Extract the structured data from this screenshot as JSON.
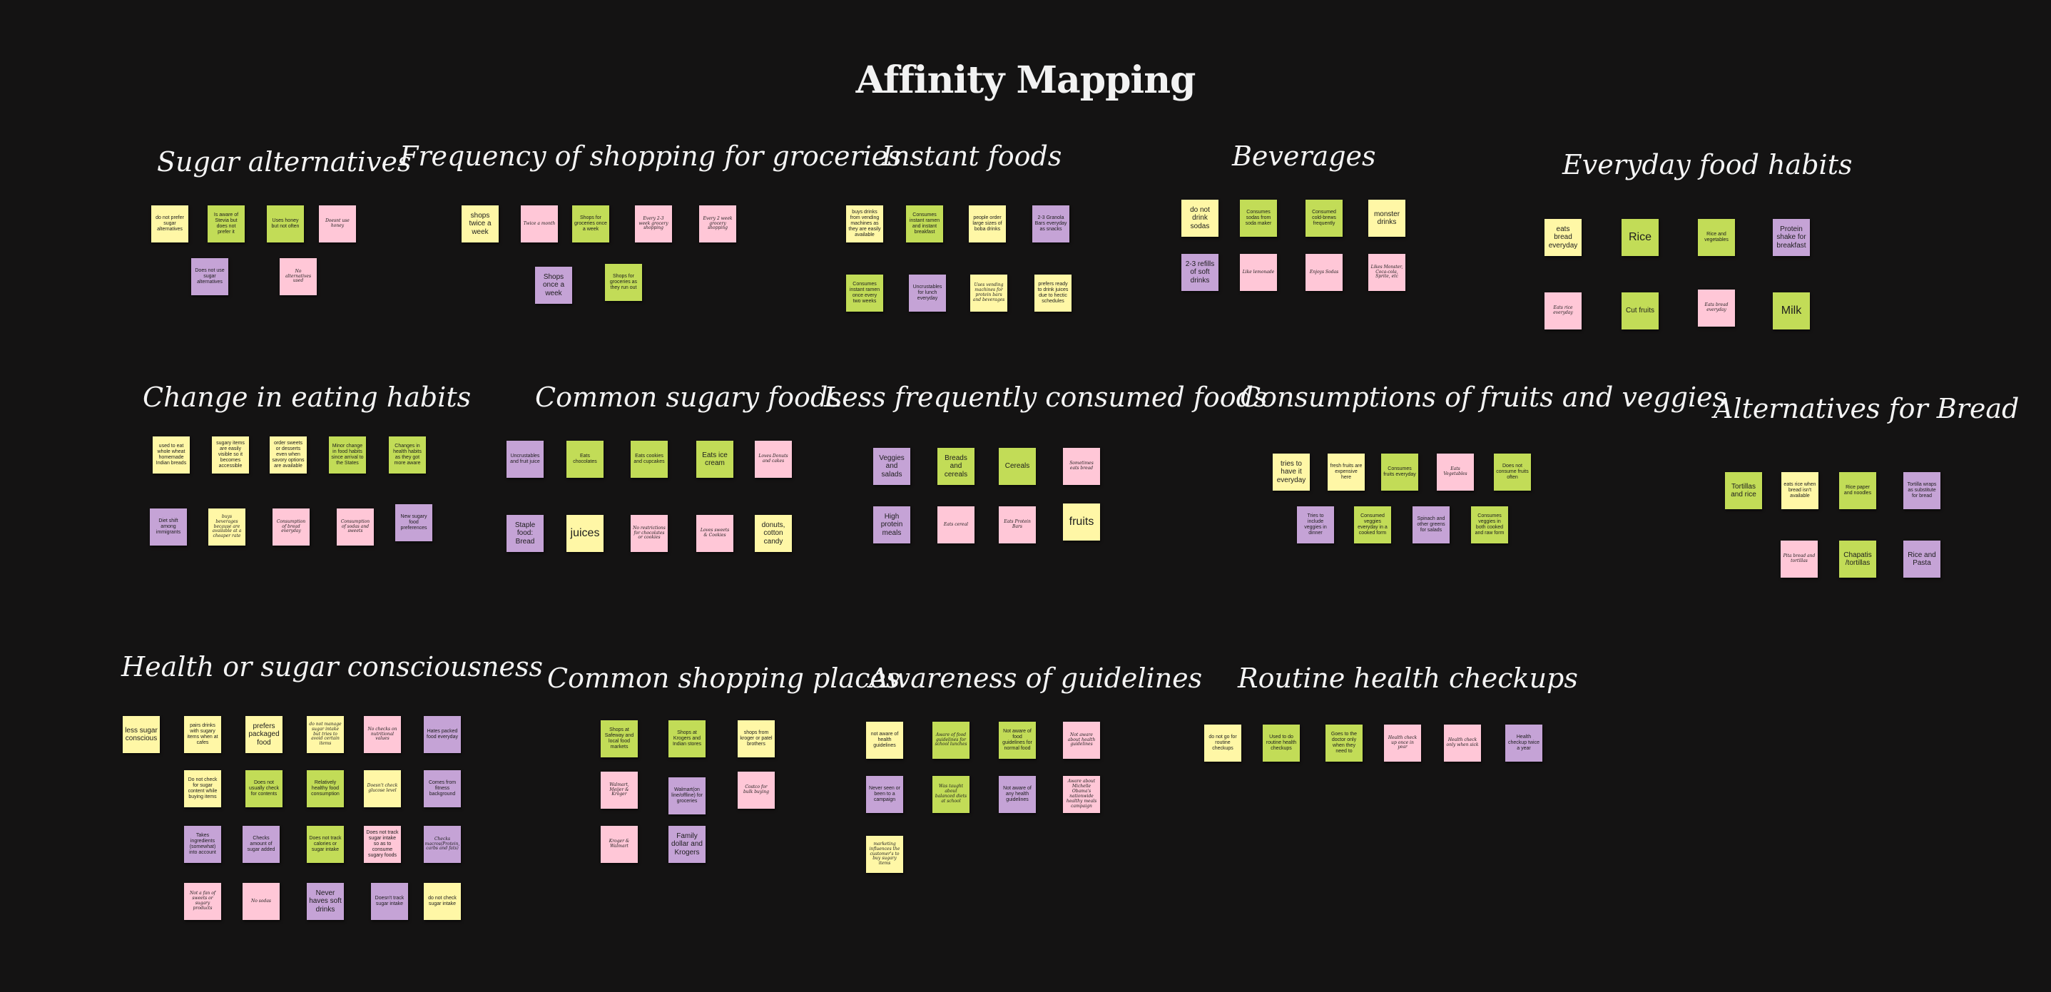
{
  "title": "Affinity Mapping",
  "colors": {
    "background": "#141313",
    "yellow": "#fff7a6",
    "green": "#c2dc57",
    "pink": "#ffc7d7",
    "purple": "#c5a3d6"
  },
  "clusters": [
    {
      "title": "Sugar alternatives",
      "notes": [
        "do not prefer sugar alternatives",
        "Is aware of Stevia but does not prefer it",
        "Uses honey but not often",
        "Doesnt use honey",
        "Does not use sugar alternatives",
        "No alternatives used"
      ]
    },
    {
      "title": "Frequency of shopping for groceries",
      "notes": [
        "shops twice a week",
        "Twice a month",
        "Shops for groceries once a week",
        "Every 2-3 week grocery shopping",
        "Every 2 week grocery shopping",
        "Shops once a week",
        "Shops for groceries as they run out"
      ]
    },
    {
      "title": "Instant foods",
      "notes": [
        "buys drinks from vending machines as they are easily available",
        "Consumes instant ramen and instant breakfast",
        "people order large sizes of boba drinks",
        "2-3 Granola Bars everyday as snacks",
        "Consumes instant ramen once every two weeks",
        "Uncrustables for lunch everyday",
        "Uses vending machines for protein bars and beverages",
        "prefers ready to drink juices due to hectic schedules"
      ]
    },
    {
      "title": "Beverages",
      "notes": [
        "do not drink sodas",
        "Consumes sodas from soda maker",
        "Consumed cold-brews frequently",
        "monster drinks",
        "2-3 refills of soft drinks",
        "Like lemonade",
        "Enjoys Sodas",
        "Likes Monster, Coca-cola, Sprite, etc"
      ]
    },
    {
      "title": "Everyday food habits",
      "notes": [
        "eats bread everyday",
        "Rice",
        "Rice and vegetables",
        "Protein shake for breakfast",
        "Eats rice everyday",
        "Cut fruits",
        "Eats bread everyday",
        "Milk"
      ]
    },
    {
      "title": "Change in eating habits",
      "notes": [
        "used to eat whole wheat homemade Indian breads",
        "sugary items are easily visible so it becomes accessible",
        "order sweets or desserts even when savory options are available",
        "Minor change in food habits since arrival to the States",
        "Changes in health habits as they got more aware",
        "Diet shift among immigrants",
        "buys beverages because are available at a cheaper rate",
        "Consumption of bread everyday",
        "Consumption of sodas and sweets",
        "New sugary food preferences"
      ]
    },
    {
      "title": "Common sugary foods",
      "notes": [
        "Uncrustables and fruit juice",
        "Eats chocolates",
        "Eats cookies and cupcakes",
        "Eats ice cream",
        "Loves Donuts and cakes",
        "Staple food: Bread",
        "juices",
        "No restrictions for chocolates or cookies",
        "Loves sweets & Cookies",
        "donuts, cotton candy"
      ]
    },
    {
      "title": "Less frequently consumed foods",
      "notes": [
        "Veggies and salads",
        "Breads and cereals",
        "Cereals",
        "Sometimes eats bread",
        "High protein meals",
        "Eats cereal",
        "Eats Protein Bars",
        "fruits"
      ]
    },
    {
      "title": "Consumptions of fruits and veggies",
      "notes": [
        "tries to have it everyday",
        "fresh fruits are expensive here",
        "Consumes fruits everyday",
        "Eats Vegetables",
        "Does not consume fruits often",
        "Tries to include veggies in dinner",
        "Consumed veggies everyday in a cooked form",
        "Spinach and other greens for salads",
        "Consumes veggies in both cooked and raw form"
      ]
    },
    {
      "title": "Alternatives for Bread",
      "notes": [
        "Tortillas and rice",
        "eats rice when bread isn't available",
        "Rice paper and noodles",
        "Tortilla wraps as substitute for bread",
        "Pita bread and tortillas",
        "Chapatis /tortillas",
        "Rice and Pasta"
      ]
    },
    {
      "title": "Health or sugar consciousness",
      "notes": [
        "less sugar conscious",
        "pairs drinks with sugary items when at cafes",
        "prefers packaged food",
        "do not manage sugar intake but tries to avoid certain items",
        "No checks on nutritional values",
        "Hates packed food everyday",
        "Do not check for sugar content while buying items",
        "Does not usually check for contents",
        "Relatively healthy food consumption",
        "Doesn't check glucose level",
        "Comes from fitness background",
        "Takes ingredients (somewhat) into account",
        "Checks amount of sugar added",
        "Does not track calories or sugar intake",
        "Does not track sugar intake so as to consume sugary foods",
        "Checks macros(Protein, carbs and fats)",
        "Not a fan of sweets or sugary products",
        "No sodas",
        "Never haves soft drinks",
        "Doesn't track sugar intake",
        "do not check sugar intake"
      ]
    },
    {
      "title": "Common shopping places",
      "notes": [
        "Shops at Safeway and local food markets",
        "Shops at Krogers and Indian stores",
        "shops from kroger or patel brothers",
        "Walmart, Meijer & Kroger",
        "Walmart(on line/offline) for groceries",
        "Costco for bulk buying",
        "Kroger & Walmart",
        "Family dollar and Krogers"
      ]
    },
    {
      "title": "Awareness of guidelines",
      "notes": [
        "not aware of health guidelines",
        "Aware of food guidelines for school lunches",
        "Not aware of food guidelines for normal food",
        "Not aware about health guidelines",
        "Never seen or been to a campaign",
        "Was taught about balanced diets at school",
        "Not aware of any health guidelines",
        "Aware about Michelle Obama's nationwide healthy meals campaign",
        "marketing influences the customer's to buy sugary items"
      ]
    },
    {
      "title": "Routine health checkups",
      "notes": [
        "do not go for routine checkups",
        "Used to do routine health checkups",
        "Goes to the doctor only when they need to",
        "Health check up once in year",
        "Health check only when sick",
        "Health checkup twice a year"
      ]
    }
  ]
}
